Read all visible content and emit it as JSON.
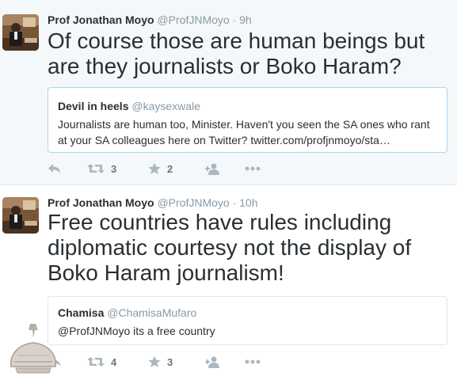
{
  "tweets": [
    {
      "fullname": "Prof Jonathan Moyo",
      "handle": "@ProfJNMoyo",
      "separator": "·",
      "time": "9h",
      "text": "Of course those are human beings but are they journalists or Boko Haram?",
      "quote": {
        "name": "Devil in heels",
        "handle": "@kaysexwale",
        "text": "Journalists are human too, Minister. Haven't you seen the SA ones who rant at your SA colleagues here on Twitter? twitter.com/profjnmoyo/sta…"
      },
      "retweets": "3",
      "favorites": "2"
    },
    {
      "fullname": "Prof Jonathan Moyo",
      "handle": "@ProfJNMoyo",
      "separator": "·",
      "time": "10h",
      "text": "Free countries have rules including diplomatic courtesy not the display of Boko Haram journalism!",
      "quote": {
        "name": "Chamisa",
        "handle": "@ChamisaMufaro",
        "text": "@ProfJNMoyo its a free country"
      },
      "retweets": "4",
      "favorites": "3"
    }
  ],
  "icons": {
    "reply": "reply-icon",
    "retweet": "retweet-icon",
    "favorite": "star-icon",
    "follow": "follow-icon",
    "more": "more-icon"
  },
  "colors": {
    "text": "#292f33",
    "meta": "#8899a6",
    "icon": "#aab8c2",
    "quote_border": "#a7d7f5"
  }
}
